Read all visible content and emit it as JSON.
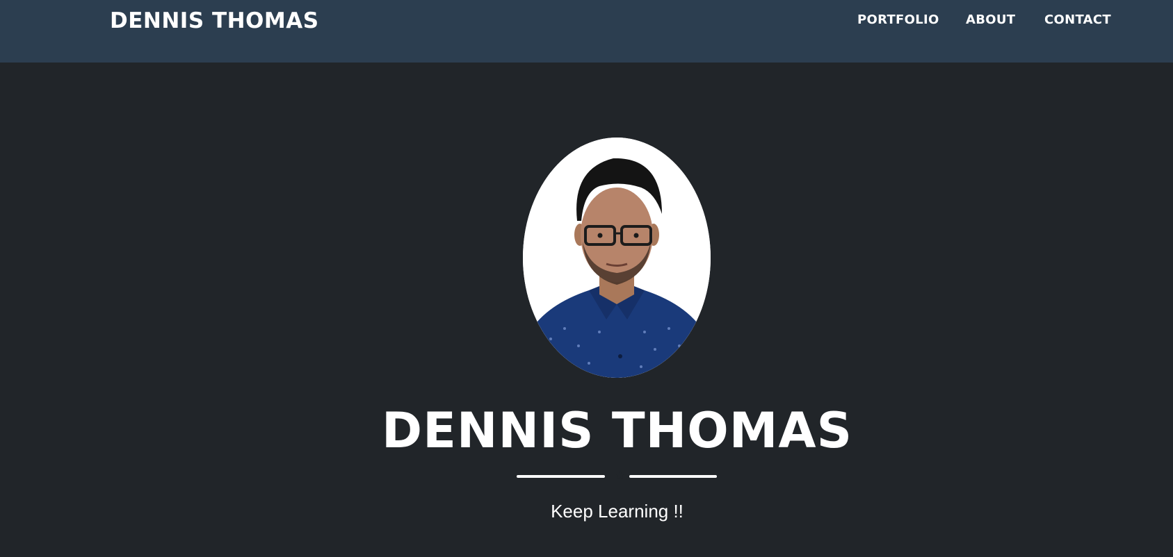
{
  "navbar": {
    "brand": "DENNIS THOMAS",
    "links": [
      {
        "label": "PORTFOLIO"
      },
      {
        "label": "ABOUT"
      },
      {
        "label": "CONTACT"
      }
    ]
  },
  "masthead": {
    "avatar_icon": "profile-photo",
    "heading": "DENNIS THOMAS",
    "divider_icon": "star-icon",
    "subheading": "Keep Learning !!"
  },
  "colors": {
    "navbar_bg": "#2c3e50",
    "page_bg": "#212529",
    "text": "#ffffff",
    "shirt": "#1a3a7a"
  }
}
